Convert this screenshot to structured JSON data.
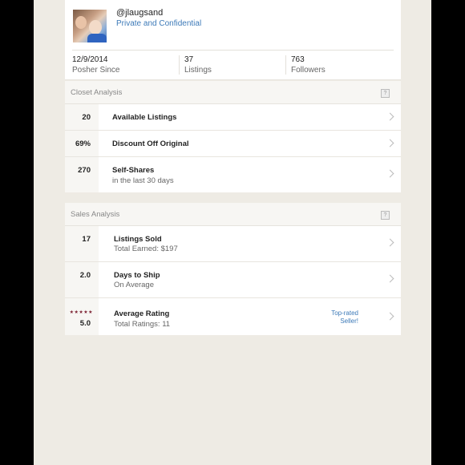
{
  "profile": {
    "username": "@jlaugsand",
    "tagline": "Private and Confidential",
    "stats": [
      {
        "value": "12/9/2014",
        "label": "Posher Since"
      },
      {
        "value": "37",
        "label": "Listings"
      },
      {
        "value": "763",
        "label": "Followers"
      }
    ]
  },
  "closet_analysis": {
    "header": "Closet Analysis",
    "help": "?",
    "rows": [
      {
        "value": "20",
        "title": "Available Listings"
      },
      {
        "value": "69%",
        "title": "Discount Off Original"
      },
      {
        "value": "270",
        "title": "Self-Shares",
        "subtitle": "in the last 30 days"
      }
    ]
  },
  "sales_analysis": {
    "header": "Sales Analysis",
    "help": "?",
    "rows": [
      {
        "value": "17",
        "title": "Listings Sold",
        "subtitle": "Total Earned: $197"
      },
      {
        "value": "2.0",
        "title": "Days to Ship",
        "subtitle": "On Average"
      },
      {
        "value": "5.0",
        "stars": "★★★★★",
        "title": "Average Rating",
        "subtitle": "Total Ratings: 11",
        "badge_line1": "Top-rated",
        "badge_line2": "Seller!"
      }
    ]
  },
  "colors": {
    "link": "#3d7ab8",
    "stars": "#7b1f2f",
    "background": "#eeebe4"
  }
}
